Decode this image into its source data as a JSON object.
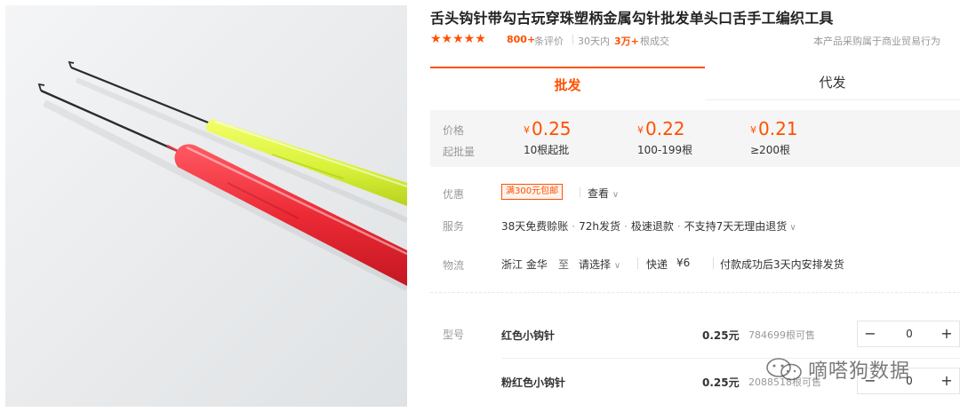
{
  "product": {
    "title": "舌头钩针带勾古玩穿珠塑柄金属勾针批发单头口舌手工编织工具",
    "stars": "★★★★★",
    "rating_count": "800+",
    "rating_label": "条评价",
    "sold_prefix": "30天内",
    "sold_count": "3万+",
    "sold_suffix": "根成交",
    "trade_note": "本产品采购属于商业贸易行为"
  },
  "tabs": [
    {
      "label": "批发",
      "active": true
    },
    {
      "label": "代发",
      "active": false
    }
  ],
  "price_box": {
    "price_label": "价格",
    "moq_label": "起批量",
    "currency": "¥",
    "tiers": [
      {
        "price": "0.25",
        "moq": "10根起批"
      },
      {
        "price": "0.22",
        "moq": "100-199根"
      },
      {
        "price": "0.21",
        "moq": "≥200根"
      }
    ]
  },
  "promotion": {
    "label": "优惠",
    "tag": "满300元包邮",
    "view_more": "查看"
  },
  "services": {
    "label": "服务",
    "items": [
      "38天免费赊账",
      "72h发货",
      "极速退款",
      "不支持7天无理由退货"
    ]
  },
  "logistics": {
    "label": "物流",
    "origin": "浙江 金华",
    "to": "至",
    "destination": "请选择",
    "method": "快递",
    "fee": "¥6",
    "note": "付款成功后3天内安排发货"
  },
  "sku": {
    "label": "型号",
    "rows": [
      {
        "name": "红色小钩针",
        "price": "0.25元",
        "stock": "784699根可售",
        "qty": "0"
      },
      {
        "name": "粉红色小钩针",
        "price": "0.25元",
        "stock": "2088518根可售",
        "qty": "0"
      }
    ],
    "minus": "−",
    "plus": "+"
  },
  "watermark": {
    "text": "嘀嗒狗数据"
  },
  "icons": {
    "chevron": "chevron-down-icon",
    "star": "star-icon"
  },
  "colors": {
    "accent": "#ff5000",
    "price_bg": "#f5f5f5",
    "muted_text": "#999999"
  }
}
